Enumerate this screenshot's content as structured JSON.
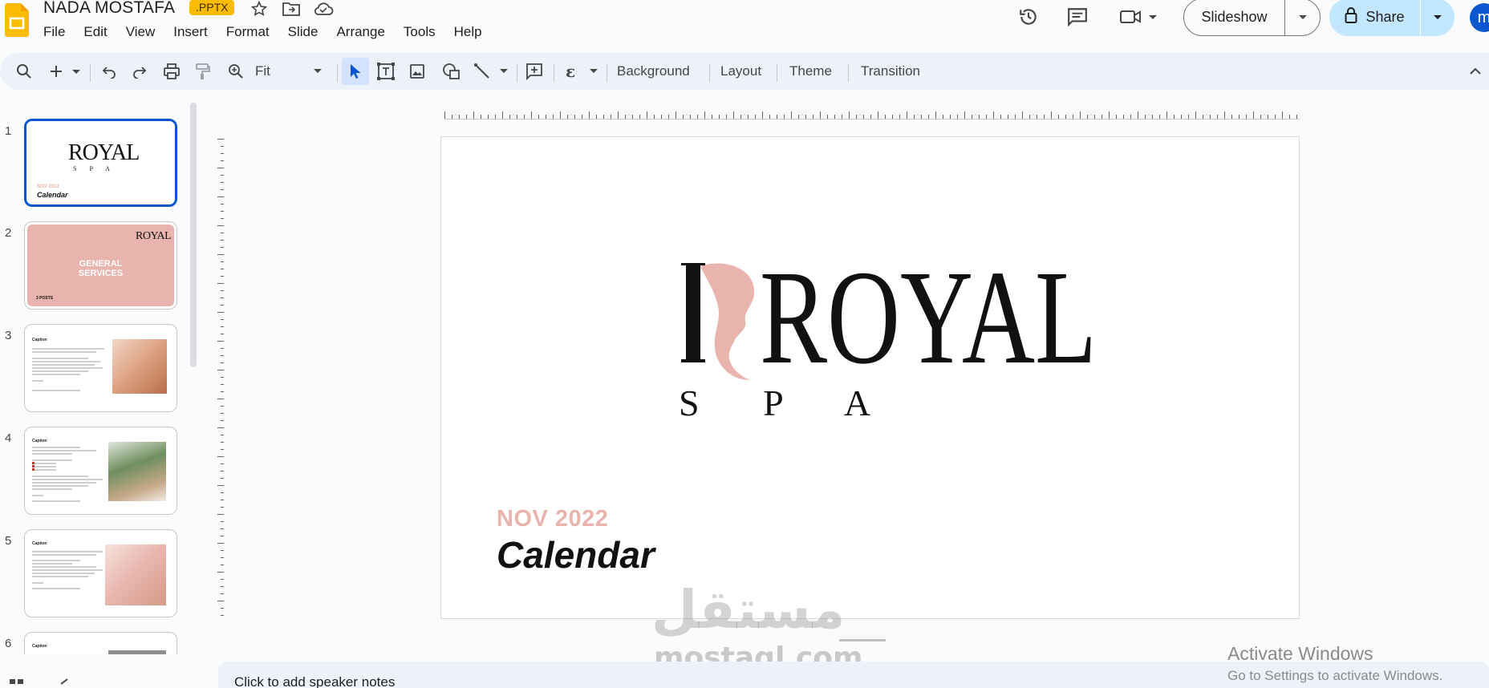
{
  "header": {
    "doc_title": "NADA MOSTAFA",
    "file_badge": ".PPTX",
    "menus": [
      "File",
      "Edit",
      "View",
      "Insert",
      "Format",
      "Slide",
      "Arrange",
      "Tools",
      "Help"
    ],
    "slideshow_label": "Slideshow",
    "share_label": "Share",
    "avatar_letter": "m"
  },
  "toolbar": {
    "zoom_value": "Fit",
    "background_label": "Background",
    "layout_label": "Layout",
    "theme_label": "Theme",
    "transition_label": "Transition"
  },
  "filmstrip": {
    "slides": [
      {
        "number": "1",
        "date_label": "NOV 2022",
        "title": "Calendar",
        "brand": "ROYAL",
        "sub": "S P A"
      },
      {
        "number": "2",
        "heading": "GENERAL SERVICES",
        "footer": "3 POSTS",
        "brand": "ROYAL"
      },
      {
        "number": "3",
        "heading": "Caption"
      },
      {
        "number": "4",
        "heading": "Caption"
      },
      {
        "number": "5",
        "heading": "Caption"
      },
      {
        "number": "6",
        "heading": "Caption"
      }
    ]
  },
  "slide": {
    "logo_word": "ROYAL",
    "logo_sub": "S P A",
    "date_label": "NOV 2022",
    "title": "Calendar"
  },
  "notes": {
    "placeholder": "Click to add speaker notes"
  },
  "watermarks": {
    "arabic": "مستقل",
    "latin": "mostaql.com",
    "activate_title": "Activate Windows",
    "activate_sub": "Go to Settings to activate Windows."
  },
  "colors": {
    "brand_pink": "#e8b4ad",
    "accent_blue": "#0b57d0",
    "share_bg": "#c2e7ff",
    "slides_yellow": "#fbbc04"
  }
}
